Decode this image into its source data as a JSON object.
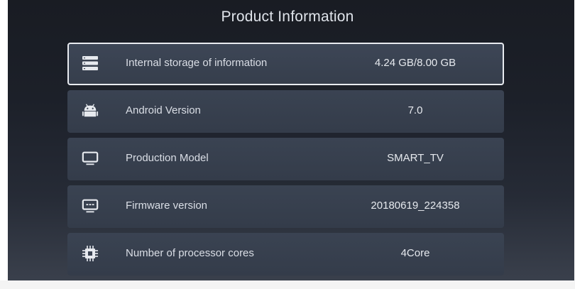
{
  "title": "Product Information",
  "items": [
    {
      "icon": "storage-icon",
      "label": "Internal storage of information",
      "value": "4.24 GB/8.00 GB",
      "focused": true
    },
    {
      "icon": "android-icon",
      "label": "Android Version",
      "value": "7.0"
    },
    {
      "icon": "tv-monitor-icon",
      "label": "Production Model",
      "value": "SMART_TV"
    },
    {
      "icon": "firmware-icon",
      "label": "Firmware version",
      "value": "20180619_224358"
    },
    {
      "icon": "processor-chip-icon",
      "label": "Number of processor cores",
      "value": "4Core"
    }
  ],
  "colors": {
    "background": "#1c2029",
    "row": "#38404e",
    "focus_border": "#e8ebf0",
    "text": "#dadee6"
  }
}
